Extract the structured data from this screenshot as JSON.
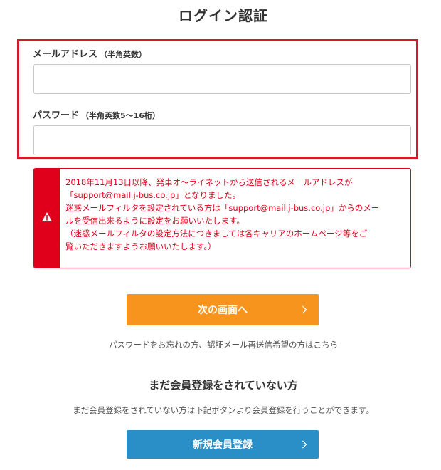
{
  "header": {
    "title": "ログイン認証"
  },
  "form": {
    "email_label": "メールアドレス",
    "email_hint": "（半角英数）",
    "email_value": "",
    "password_label": "パスワード",
    "password_hint": "（半角英数5〜16桁）",
    "password_value": ""
  },
  "notice": {
    "icon": "warning-icon",
    "color": "#e0001b",
    "text": "2018年11月13日以降、発車オ〜ライネットから送信されるメールアドレスが\n「support@mail.j-bus.co.jp」となりました。\n迷惑メールフィルタを設定されている方は「support@mail.j-bus.co.jp」からのメー\nルを受信出来るように設定をお願いいたします。\n（迷惑メールフィルタの設定方法につきましては各キャリアのホームページ等をご\n覧いただきますようお願いいたします。）"
  },
  "actions": {
    "next_label": "次の画面へ",
    "next_color": "#f7941d",
    "forgot_link": "パスワードをお忘れの方、認証メール再送信希望の方はこちら"
  },
  "register": {
    "title": "まだ会員登録をされていない方",
    "description": "まだ会員登録をされていない方は下記ボタンより会員登録を行うことができます。",
    "button_label": "新規会員登録",
    "button_color": "#2a8fc7"
  }
}
